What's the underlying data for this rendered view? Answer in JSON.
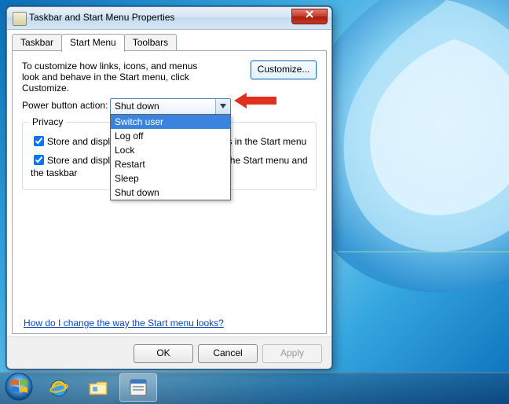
{
  "window": {
    "title": "Taskbar and Start Menu Properties"
  },
  "tabs": {
    "taskbar": "Taskbar",
    "start_menu": "Start Menu",
    "toolbars": "Toolbars"
  },
  "content": {
    "description": "To customize how links, icons, and menus look and behave in the Start menu, click Customize.",
    "customize_label": "Customize...",
    "power_label": "Power button action:",
    "power_selected": "Shut down",
    "power_options": [
      "Switch user",
      "Log off",
      "Lock",
      "Restart",
      "Sleep",
      "Shut down"
    ],
    "power_highlight_index": 0,
    "privacy_legend": "Privacy",
    "privacy_opt1": "Store and display recently opened programs in the Start menu",
    "privacy_opt2": "Store and display recently opened items in the Start menu and the taskbar",
    "help_link": "How do I change the way the Start menu looks?"
  },
  "buttons": {
    "ok": "OK",
    "cancel": "Cancel",
    "apply": "Apply"
  },
  "taskbar": {
    "start": "start-orb",
    "ie": "internet-explorer",
    "explorer": "windows-explorer",
    "dialog": "properties-dialog"
  }
}
